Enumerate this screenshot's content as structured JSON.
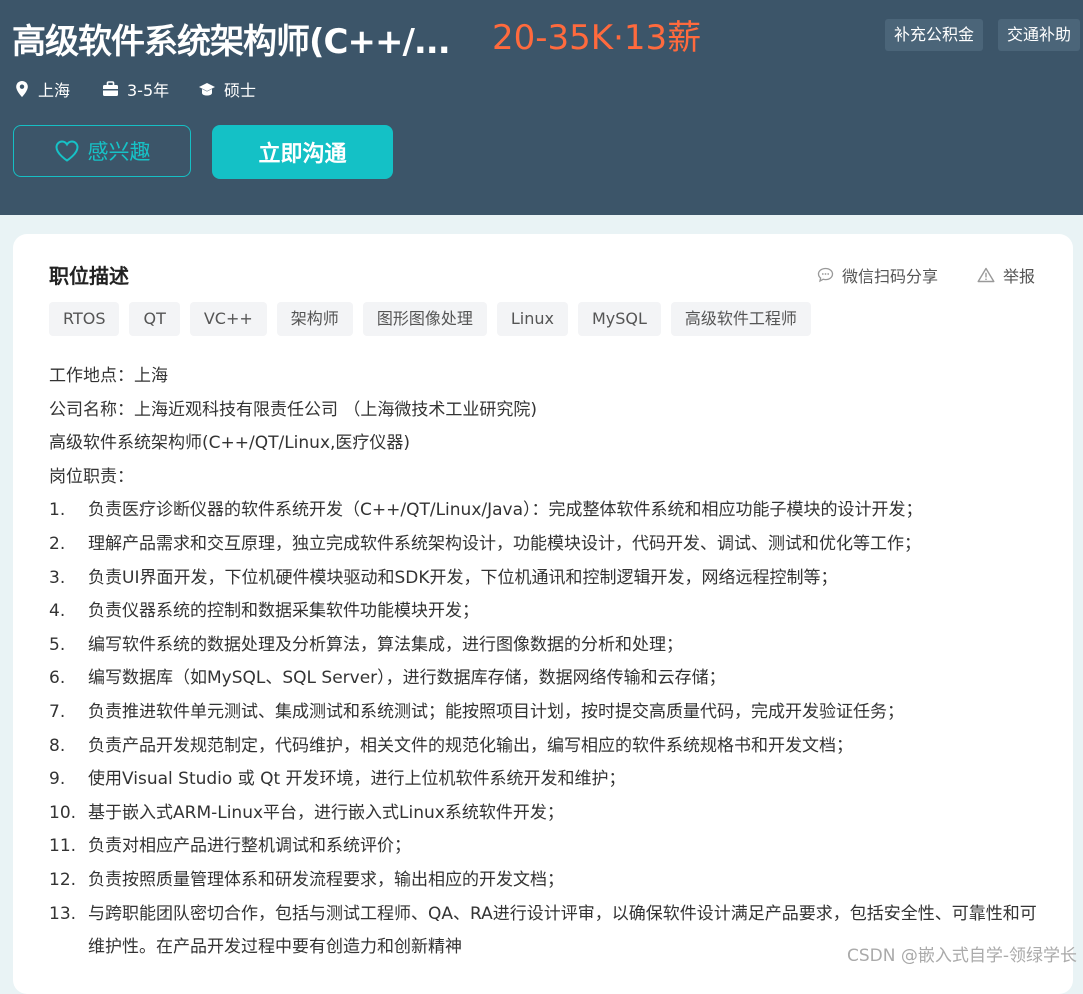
{
  "header": {
    "title": "高级软件系统架构师(C++/...",
    "salary": "20-35K·13薪",
    "benefits": [
      "补充公积金",
      "交通补助"
    ],
    "meta": [
      {
        "icon": "location-pin-icon",
        "text": "上海"
      },
      {
        "icon": "briefcase-icon",
        "text": "3-5年"
      },
      {
        "icon": "graduation-cap-icon",
        "text": "硕士"
      }
    ],
    "interest_label": "感兴趣",
    "chat_label": "立即沟通"
  },
  "colors": {
    "header_bg": "#3c5569",
    "salary": "#ff6a3d",
    "accent": "#14c1c6"
  },
  "section": {
    "title": "职位描述",
    "share_label": "微信扫码分享",
    "report_label": "举报",
    "tags": [
      "RTOS",
      "QT",
      "VC++",
      "架构师",
      "图形图像处理",
      "Linux",
      "MySQL",
      "高级软件工程师"
    ]
  },
  "description": {
    "lines": [
      "工作地点：上海",
      "公司名称：上海近观科技有限责任公司 （上海微技术工业研究院)",
      "高级软件系统架构师(C++/QT/Linux,医疗仪器)",
      "岗位职责："
    ],
    "items": [
      {
        "num": "1.",
        "text": "负责医疗诊断仪器的软件系统开发（C++/QT/Linux/Java）：完成整体软件系统和相应功能子模块的设计开发；"
      },
      {
        "num": "2.",
        "text": "理解产品需求和交互原理，独立完成软件系统架构设计，功能模块设计，代码开发、调试、测试和优化等工作；"
      },
      {
        "num": "3.",
        "text": "负责UI界面开发，下位机硬件模块驱动和SDK开发，下位机通讯和控制逻辑开发，网络远程控制等；"
      },
      {
        "num": "4.",
        "text": "负责仪器系统的控制和数据采集软件功能模块开发；"
      },
      {
        "num": "5.",
        "text": "编写软件系统的数据处理及分析算法，算法集成，进行图像数据的分析和处理；"
      },
      {
        "num": "6.",
        "text": "编写数据库（如MySQL、SQL Server），进行数据库存储，数据网络传输和云存储；"
      },
      {
        "num": "7.",
        "text": "负责推进软件单元测试、集成测试和系统测试；能按照项目计划，按时提交高质量代码，完成开发验证任务；"
      },
      {
        "num": "8.",
        "text": "负责产品开发规范制定，代码维护，相关文件的规范化输出，编写相应的软件系统规格书和开发文档；"
      },
      {
        "num": "9.",
        "text": "使用Visual Studio 或 Qt 开发环境，进行上位机软件系统开发和维护；"
      },
      {
        "num": "10.",
        "text": "基于嵌入式ARM-Linux平台，进行嵌入式Linux系统软件开发；"
      },
      {
        "num": "11.",
        "text": "负责对相应产品进行整机调试和系统评价；"
      },
      {
        "num": "12.",
        "text": "负责按照质量管理体系和研发流程要求，输出相应的开发文档；"
      },
      {
        "num": "13.",
        "text": "与跨职能团队密切合作，包括与测试工程师、QA、RA进行设计评审，以确保软件设计满足产品要求，包括安全性、可靠性和可维护性。在产品开发过程中要有创造力和创新精神"
      }
    ]
  },
  "watermark": "CSDN @嵌入式自学-领绿学长"
}
